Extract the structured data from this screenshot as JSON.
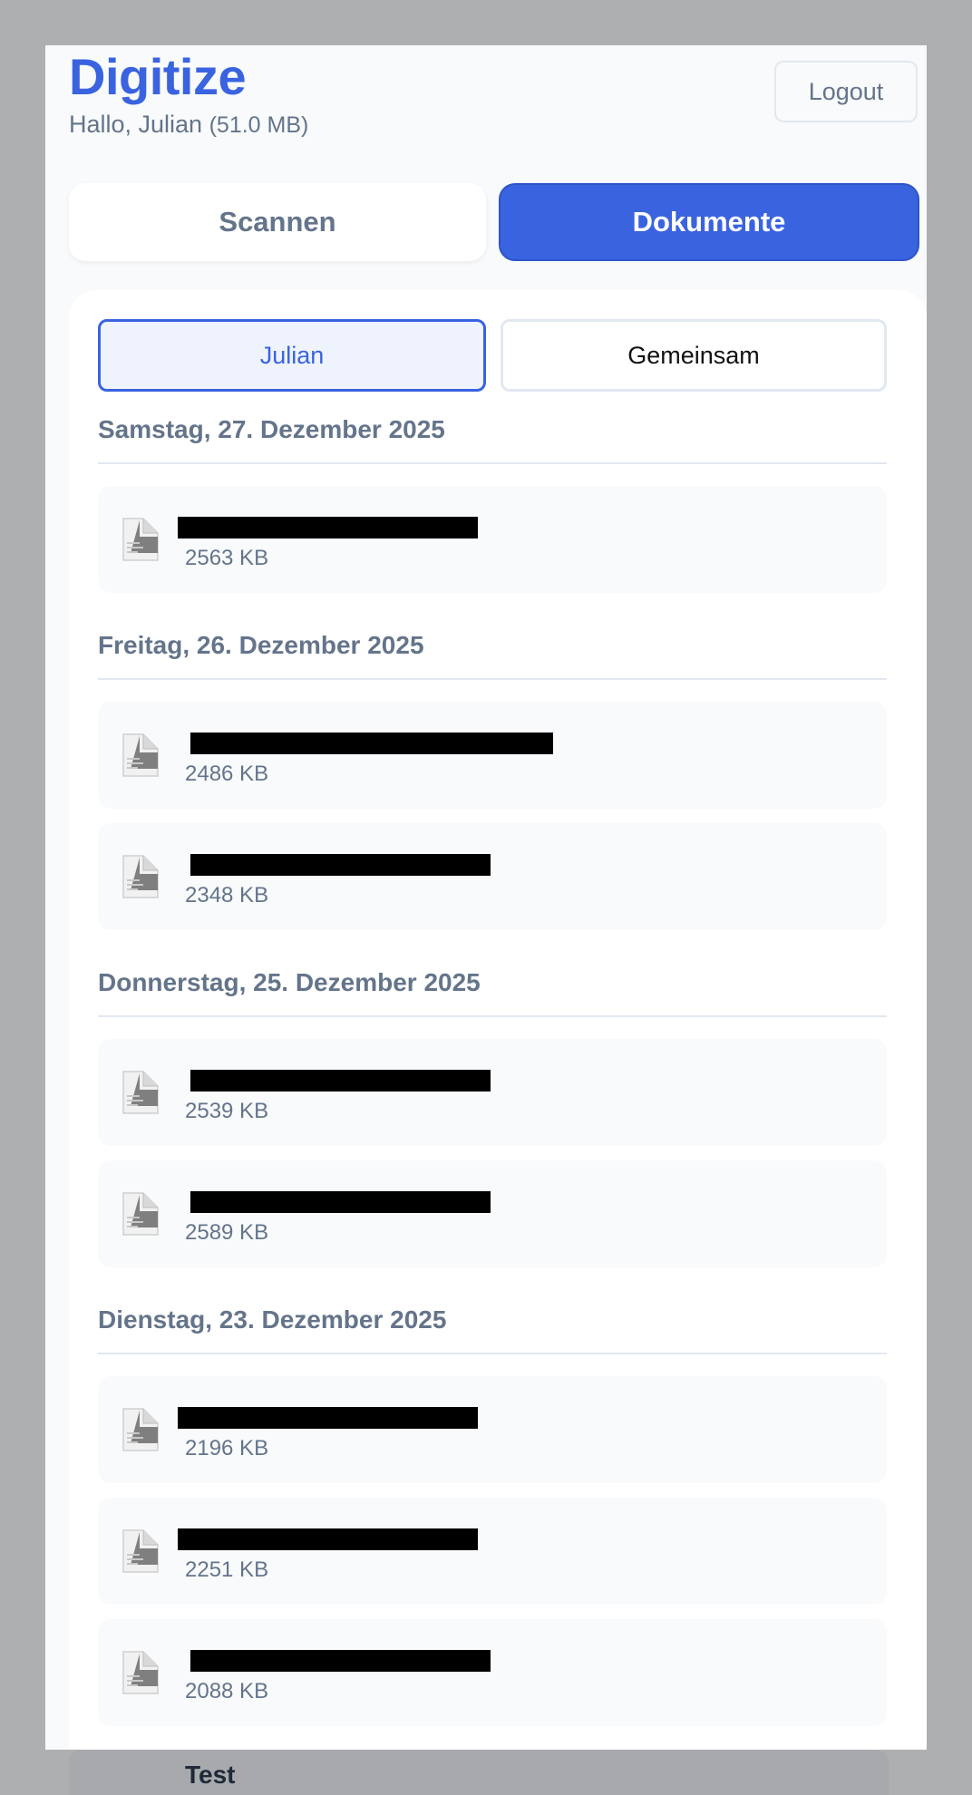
{
  "app": {
    "title": "Digitize",
    "greeting": "Hallo, Julian",
    "quota": "(51.0 MB)",
    "logout_label": "Logout"
  },
  "main_tabs": {
    "scan_label": "Scannen",
    "documents_label": "Dokumente",
    "active": "documents"
  },
  "sub_tabs": {
    "personal_label": "Julian",
    "shared_label": "Gemeinsam",
    "active": "personal"
  },
  "groups": [
    {
      "date": "Samstag, 27. Dezember 2025",
      "docs": [
        {
          "name": "",
          "size": "2563 KB",
          "redacted": true
        }
      ]
    },
    {
      "date": "Freitag, 26. Dezember 2025",
      "docs": [
        {
          "name": "",
          "size": "2486 KB",
          "redacted": true
        },
        {
          "name": "",
          "size": "2348 KB",
          "redacted": true
        }
      ]
    },
    {
      "date": "Donnerstag, 25. Dezember 2025",
      "docs": [
        {
          "name": "",
          "size": "2539 KB",
          "redacted": true
        },
        {
          "name": "",
          "size": "2589 KB",
          "redacted": true
        }
      ]
    },
    {
      "date": "Dienstag, 23. Dezember 2025",
      "docs": [
        {
          "name": "",
          "size": "2196 KB",
          "redacted": true
        },
        {
          "name": "",
          "size": "2251 KB",
          "redacted": true
        },
        {
          "name": "",
          "size": "2088 KB",
          "redacted": true
        }
      ]
    }
  ],
  "partial_item": {
    "title": "Test"
  },
  "colors": {
    "accent": "#3a63e0",
    "muted_text": "#64748b",
    "backdrop": "#aeafb1"
  },
  "icons": {
    "document": "document-thumbnail-icon"
  }
}
